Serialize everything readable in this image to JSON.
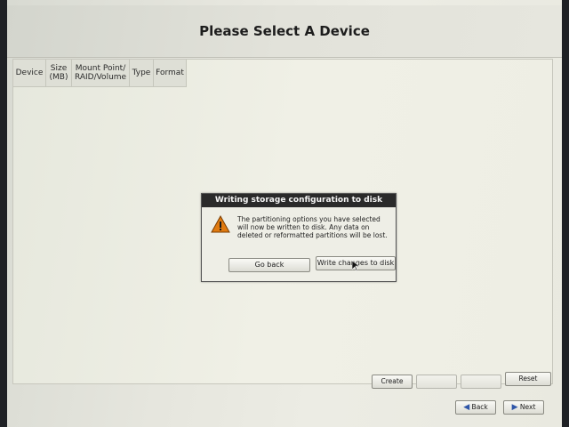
{
  "page": {
    "title": "Please Select A Device"
  },
  "table": {
    "columns": [
      "Device",
      "Size\n(MB)",
      "Mount Point/\nRAID/Volume",
      "Type",
      "Format"
    ]
  },
  "dialog": {
    "title": "Writing storage configuration to disk",
    "icon": "warning-icon",
    "message": "The partitioning options you have selected will now be written to disk.  Any data on deleted or reformatted partitions will be lost.",
    "go_back_label": "Go back",
    "write_label": "Write changes to disk"
  },
  "toolbar": {
    "create_label": "Create",
    "reset_label": "Reset"
  },
  "nav": {
    "back_label": "Back",
    "next_label": "Next"
  },
  "colors": {
    "accent": "#2f56a8",
    "warning": "#e07a10"
  }
}
